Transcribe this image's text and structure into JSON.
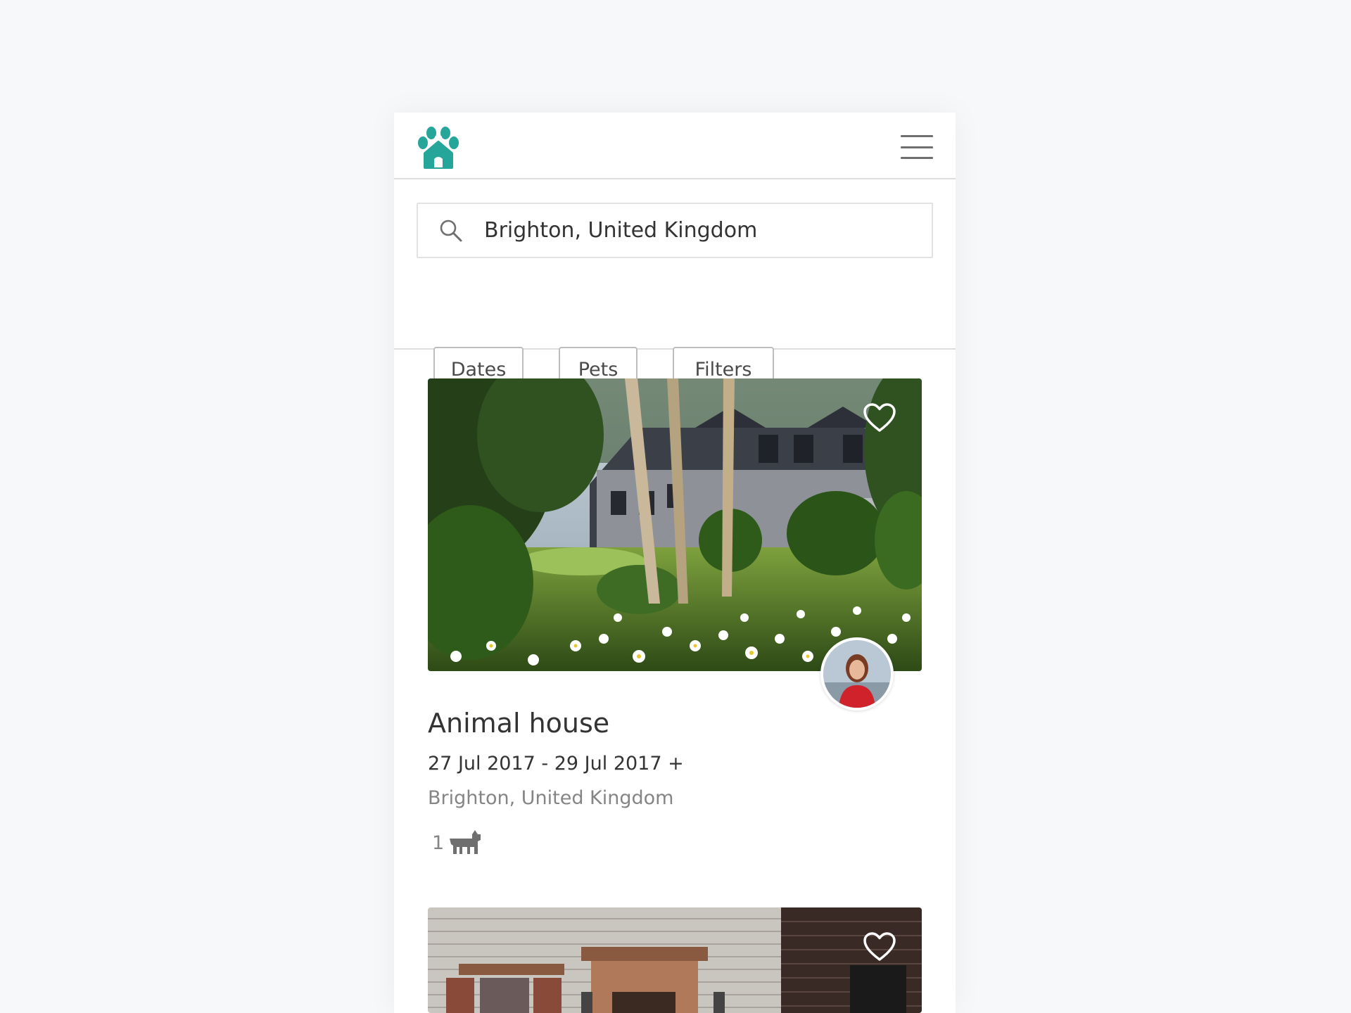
{
  "app": {
    "brand_color": "#26a69a"
  },
  "header": {
    "logo_icon": "paw-house-icon",
    "menu_icon": "hamburger-menu-icon"
  },
  "search": {
    "icon": "search-icon",
    "value": "Brighton, United Kingdom",
    "placeholder": ""
  },
  "filters": [
    {
      "label": "Dates"
    },
    {
      "label": "Pets"
    },
    {
      "label": "Filters"
    }
  ],
  "listings": [
    {
      "title": "Animal house",
      "dates": "27 Jul 2017 - 29 Jul 2017 +",
      "location": "Brighton, United Kingdom",
      "pet_count": "1",
      "pet_icon": "dog-icon",
      "favorite_icon": "heart-icon",
      "image": "house-garden-photo",
      "host_avatar": "host-avatar-photo"
    },
    {
      "favorite_icon": "heart-icon",
      "image": "townhouse-facade-photo"
    }
  ]
}
